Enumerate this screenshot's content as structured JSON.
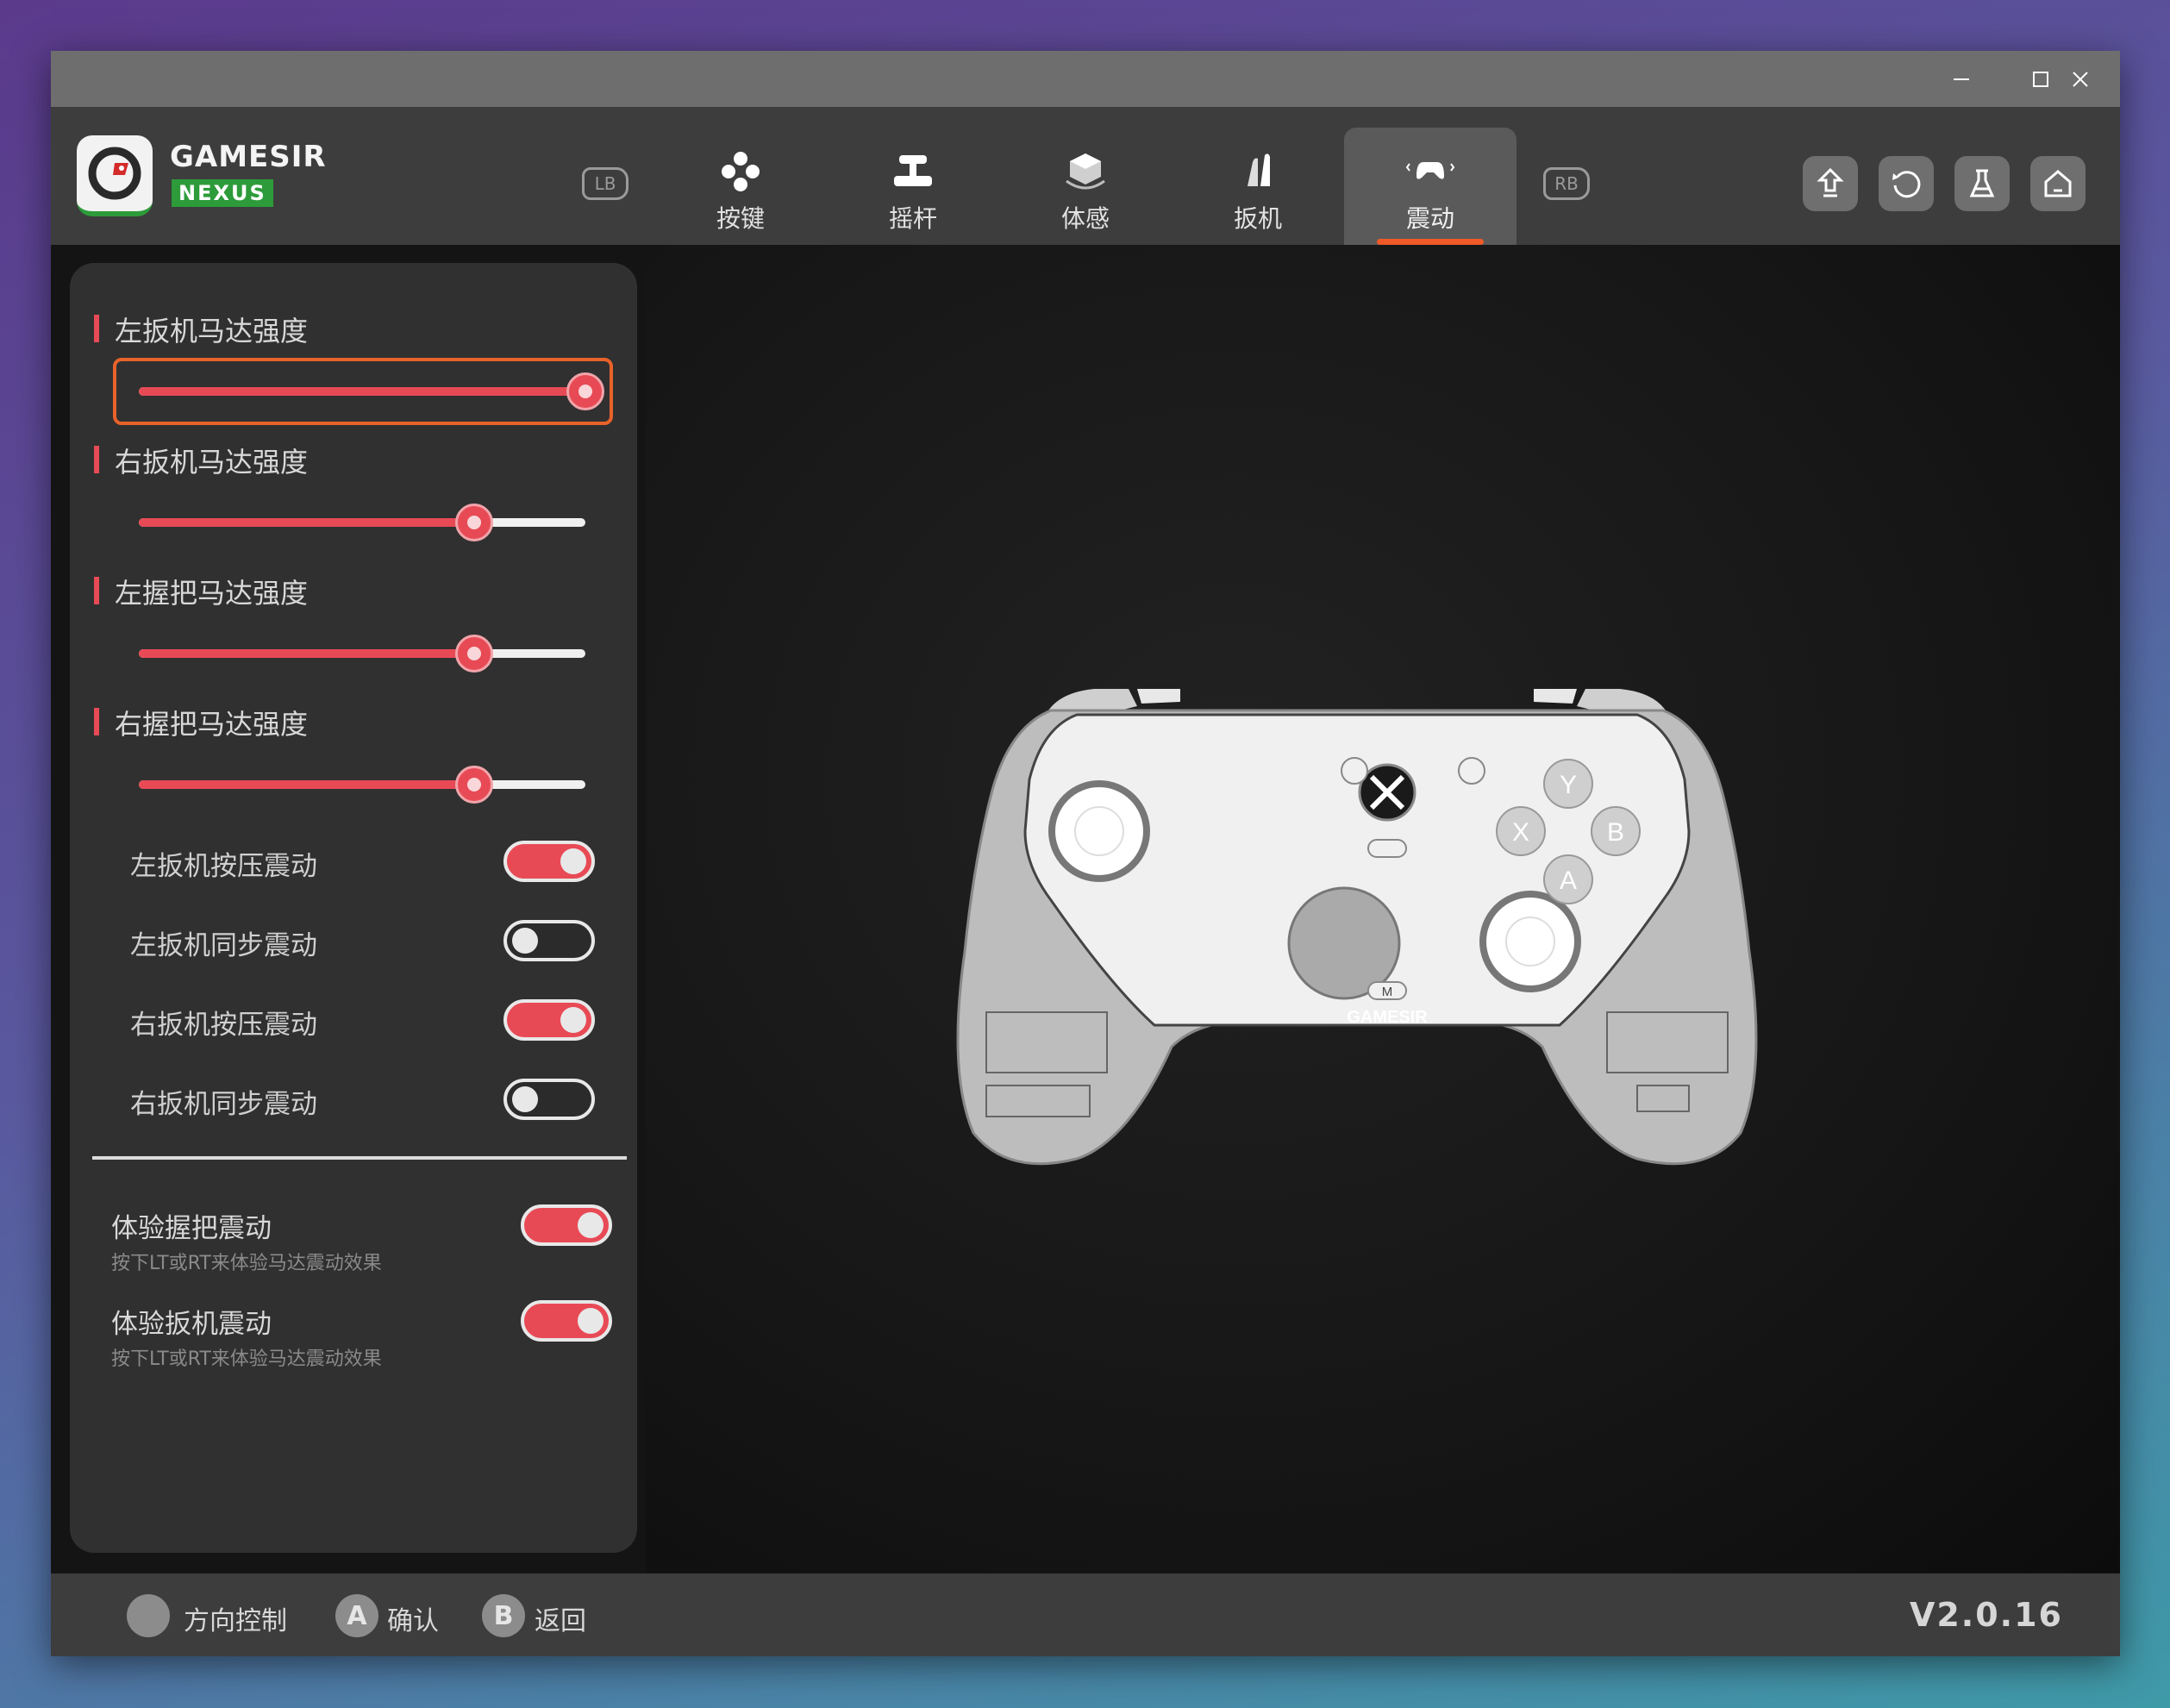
{
  "app": {
    "brand_top": "GAMESIR",
    "brand_bottom": "NEXUS",
    "accent_color": "#e84a55",
    "focus_color": "#e8622a",
    "brand_green": "#2d9b3a"
  },
  "window_controls": [
    "minimize-icon",
    "maximize-icon",
    "close-icon"
  ],
  "nav": {
    "left_bumper": "LB",
    "right_bumper": "RB",
    "tabs": [
      {
        "label": "按键",
        "icon": "buttons-icon",
        "active": false
      },
      {
        "label": "摇杆",
        "icon": "joystick-icon",
        "active": false
      },
      {
        "label": "体感",
        "icon": "motion-icon",
        "active": false
      },
      {
        "label": "扳机",
        "icon": "trigger-icon",
        "active": false
      },
      {
        "label": "震动",
        "icon": "gamepad-vibration-icon",
        "active": true
      }
    ],
    "header_buttons": [
      "upload-icon",
      "reset-icon",
      "flask-icon",
      "home-icon"
    ]
  },
  "panel": {
    "sliders": [
      {
        "label": "左扳机马达强度",
        "value_pct": 100,
        "focused": true
      },
      {
        "label": "右扳机马达强度",
        "value_pct": 75,
        "focused": false
      },
      {
        "label": "左握把马达强度",
        "value_pct": 75,
        "focused": false
      },
      {
        "label": "右握把马达强度",
        "value_pct": 75,
        "focused": false
      }
    ],
    "toggles": [
      {
        "label": "左扳机按压震动",
        "on": true
      },
      {
        "label": "左扳机同步震动",
        "on": false
      },
      {
        "label": "右扳机按压震动",
        "on": true
      },
      {
        "label": "右扳机同步震动",
        "on": false
      }
    ],
    "experience": [
      {
        "title": "体验握把震动",
        "subtitle": "按下LT或RT来体验马达震动效果",
        "on": true
      },
      {
        "title": "体验扳机震动",
        "subtitle": "按下LT或RT来体验马达震动效果",
        "on": true
      }
    ]
  },
  "controller": {
    "face_buttons": [
      "Y",
      "X",
      "B",
      "A"
    ],
    "m_button": "M",
    "brand_text": "GAMESIR"
  },
  "footer": {
    "hints": [
      {
        "button": "",
        "label": "方向控制"
      },
      {
        "button": "A",
        "label": "确认"
      },
      {
        "button": "B",
        "label": "返回"
      }
    ],
    "version": "V2.0.16"
  }
}
